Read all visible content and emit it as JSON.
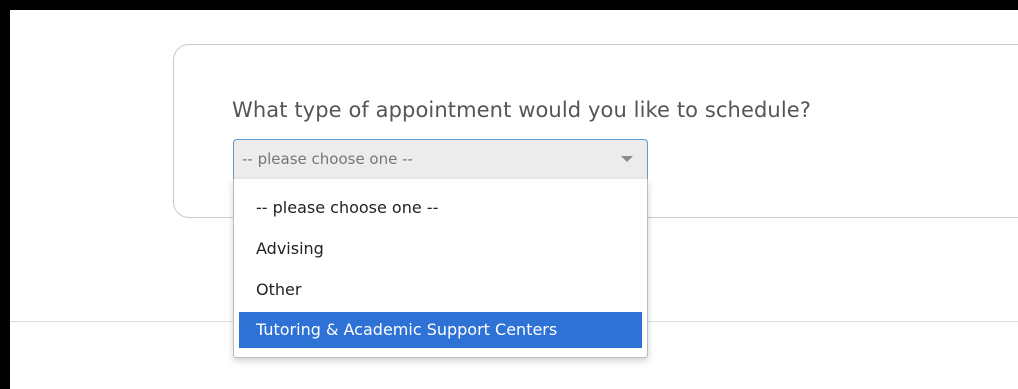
{
  "form": {
    "question": "What type of appointment would you like to schedule?",
    "select": {
      "value": "-- please choose one --",
      "options": [
        "-- please choose one --",
        "Advising",
        "Other",
        "Tutoring & Academic Support Centers"
      ],
      "highlighted_option": "Tutoring & Academic Support Centers"
    }
  },
  "colors": {
    "highlight": "#2f72d6",
    "focus_border": "#5b9bd5",
    "select_background": "#ececec"
  }
}
